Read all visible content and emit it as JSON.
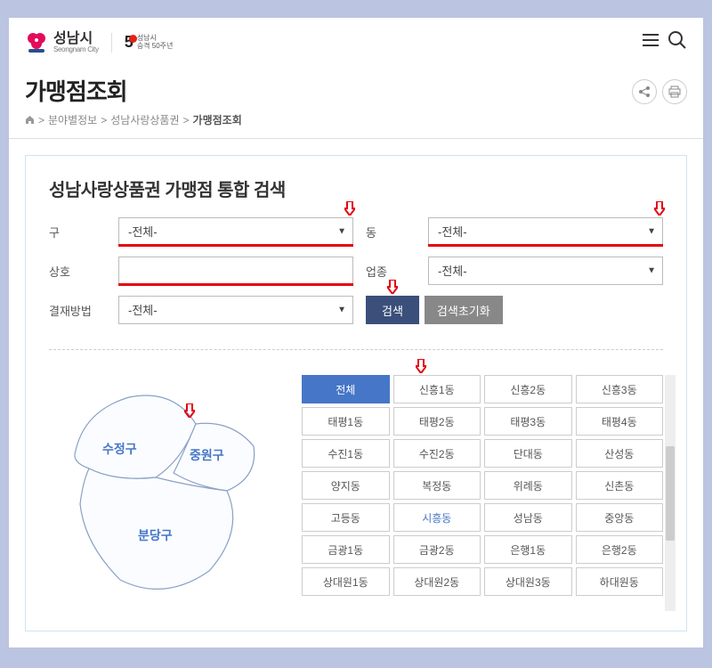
{
  "header": {
    "logo_kr": "성남시",
    "logo_en": "Seongnam City",
    "anniv_num": "5",
    "anniv_line1": "성남시",
    "anniv_line2": "승격 50주년"
  },
  "page": {
    "title": "가맹점조회",
    "breadcrumb": {
      "item1": "분야별정보",
      "item2": "성남사랑상품권",
      "item3": "가맹점조회"
    },
    "subtitle": "성남사랑상품권 가맹점 통합 검색"
  },
  "form": {
    "gu_label": "구",
    "gu_value": "-전체-",
    "dong_label": "동",
    "dong_value": "-전체-",
    "name_label": "상호",
    "name_value": "",
    "cat_label": "업종",
    "cat_value": "-전체-",
    "pay_label": "결재방법",
    "pay_value": "-전체-",
    "search_btn": "검색",
    "reset_btn": "검색초기화"
  },
  "map": {
    "regions": {
      "sj": "수정구",
      "jw": "중원구",
      "bd": "분당구"
    }
  },
  "dongs": {
    "all": "전체",
    "list": [
      "신흥1동",
      "신흥2동",
      "신흥3동",
      "태평1동",
      "태평2동",
      "태평3동",
      "태평4동",
      "수진1동",
      "수진2동",
      "단대동",
      "산성동",
      "양지동",
      "복정동",
      "위례동",
      "신촌동",
      "고등동",
      "시흥동",
      "성남동",
      "중앙동",
      "금광1동",
      "금광2동",
      "은행1동",
      "은행2동",
      "상대원1동",
      "상대원2동",
      "상대원3동",
      "하대원동"
    ],
    "highlight_index": 16
  }
}
